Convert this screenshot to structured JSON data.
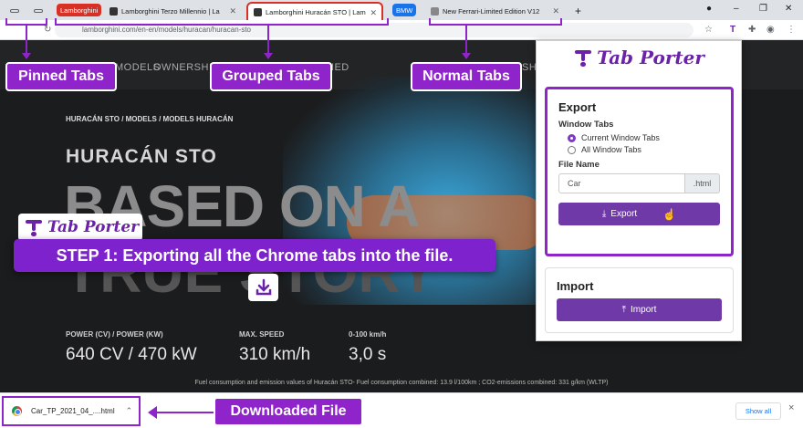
{
  "browser": {
    "tabs": {
      "group1_label": "Lamborghini",
      "group1_color": "#d93025",
      "tab1_title": "Lamborghini Terzo Millennio | La",
      "tab2_title": "Lamborghini Huracán STO | Lam",
      "group2_label": "BMW",
      "group2_color": "#1a73e8",
      "tab3_title": "New Ferrari-Limited Edition V12",
      "new_tab": "+"
    },
    "address": "lamborghini.com/en-en/models/huracan/huracan-sto"
  },
  "site": {
    "nav": [
      "MODELS",
      "OWNERSHIP",
      "NED",
      "SH"
    ],
    "breadcrumb": "HURACÁN STO / MODELS / MODELS HURACÁN",
    "model_name": "HURACÁN STO",
    "headline": "BASED ON A",
    "headline2": "TRUE STORY",
    "specs": [
      {
        "label": "POWER (CV) / POWER (KW)",
        "value": "640 CV / 470 kW"
      },
      {
        "label": "MAX. SPEED",
        "value": "310 km/h"
      },
      {
        "label": "0-100 km/h",
        "value": "3,0 s"
      }
    ],
    "fuel_note": "Fuel consumption and emission values of Huracán STO- Fuel consumption combined: 13.9 l/100km ; CO2-emissions combined: 331 g/km (WLTP)"
  },
  "annotations": {
    "pinned": "Pinned Tabs",
    "grouped": "Grouped Tabs",
    "normal": "Normal Tabs",
    "downloaded": "Downloaded File",
    "step": "STEP 1: Exporting all the Chrome tabs into the file.",
    "brand": "Tab Porter",
    "accent": "#8e24c9"
  },
  "popup": {
    "title": "Tab Porter",
    "export": {
      "heading": "Export",
      "window_tabs_label": "Window Tabs",
      "option_current": "Current Window Tabs",
      "option_all": "All Window Tabs",
      "selected": "Current Window Tabs",
      "file_name_label": "File Name",
      "file_name_value": "Car",
      "extension": ".html",
      "button": "Export"
    },
    "import": {
      "heading": "Import",
      "button": "Import"
    }
  },
  "downloads": {
    "file_name": "Car_TP_2021_04_....html",
    "show_all": "Show all",
    "close": "×"
  }
}
